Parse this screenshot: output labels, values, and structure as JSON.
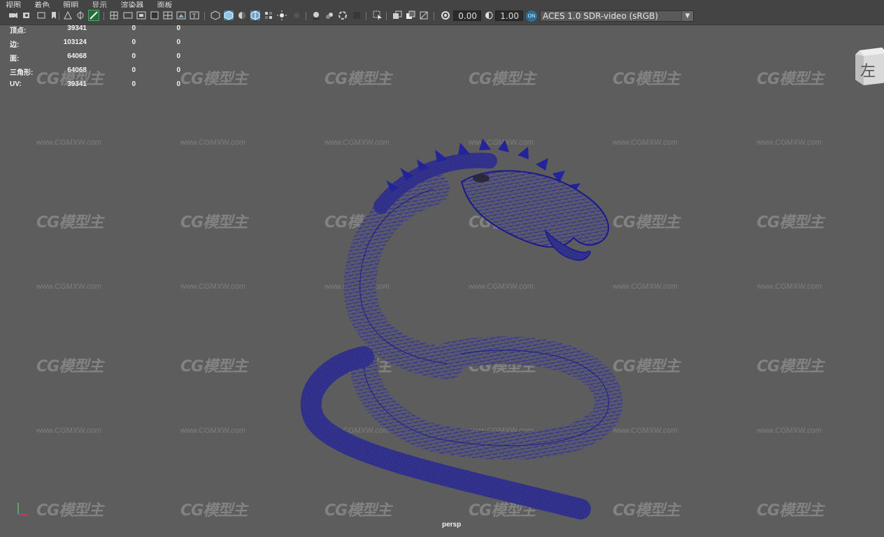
{
  "menu": {
    "items": [
      "视图",
      "着色",
      "照明",
      "显示",
      "渲染器",
      "面板"
    ]
  },
  "toolbar": {
    "exposure_value": "0.00",
    "gamma_value": "1.00",
    "aces_badge": "ON",
    "color_management": "ACES 1.0 SDR-video (sRGB)"
  },
  "hud": {
    "rows": [
      {
        "label": "顶点:",
        "v1": "39341",
        "v2": "0",
        "v3": "0"
      },
      {
        "label": "边:",
        "v1": "103124",
        "v2": "0",
        "v3": "0"
      },
      {
        "label": "面:",
        "v1": "64068",
        "v2": "0",
        "v3": "0"
      },
      {
        "label": "三角形:",
        "v1": "64068",
        "v2": "0",
        "v3": "0"
      },
      {
        "label": "UV:",
        "v1": "39341",
        "v2": "0",
        "v3": "0"
      }
    ]
  },
  "viewcube": {
    "face_label": "左"
  },
  "camera": {
    "name": "persp"
  },
  "watermark": {
    "logo": "CG模型主",
    "url": "www.CGMXW.com"
  },
  "colors": {
    "viewport_bg": "#5d5d5d",
    "toolbar_bg": "#444444",
    "wireframe": "#1a1a8c",
    "accent": "#4f7c9d"
  },
  "icons": [
    "camera-icon",
    "camera-attributes-icon",
    "bookmark-icon",
    "image-plane-icon",
    "grid-icon",
    "film-gate-icon",
    "resolution-gate-icon",
    "gate-mask-icon",
    "field-chart-icon",
    "safe-action-icon",
    "safe-title-icon",
    "wireframe-icon",
    "smooth-shade-icon",
    "shade-wireframe-icon",
    "xray-icon",
    "lights-icon",
    "shadows-icon",
    "ambient-occlusion-icon",
    "motion-blur-icon",
    "antialias-icon",
    "isolate-select-icon",
    "xray-joints-icon",
    "exposure-icon",
    "gamma-icon",
    "color-management-icon",
    "dropdown-arrow-icon"
  ]
}
